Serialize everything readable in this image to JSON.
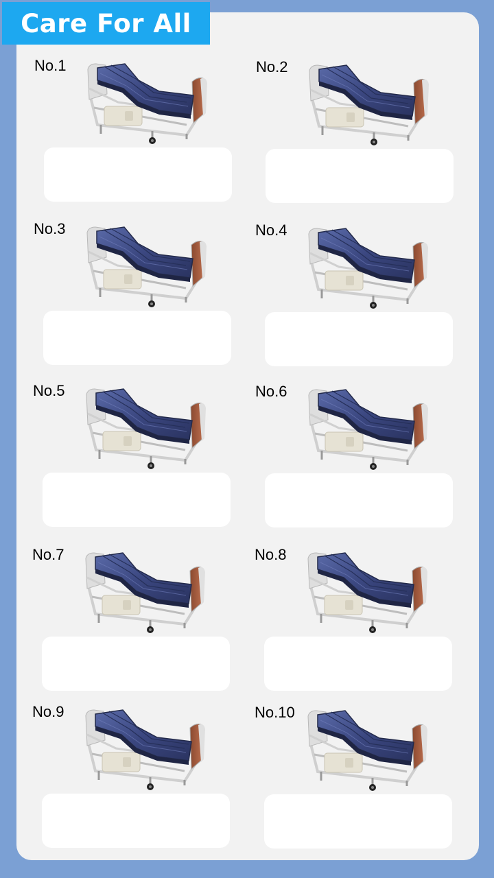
{
  "header": {
    "title": "Care For All"
  },
  "colors": {
    "background": "#7ba0d4",
    "banner": "#1da8f0",
    "panel": "#f2f2f2",
    "mattress": "#3d4a7a"
  },
  "items": [
    {
      "label": "No.1",
      "icon": "hospital-bed-icon"
    },
    {
      "label": "No.2",
      "icon": "hospital-bed-icon"
    },
    {
      "label": "No.3",
      "icon": "hospital-bed-icon"
    },
    {
      "label": "No.4",
      "icon": "hospital-bed-icon"
    },
    {
      "label": "No.5",
      "icon": "hospital-bed-icon"
    },
    {
      "label": "No.6",
      "icon": "hospital-bed-icon"
    },
    {
      "label": "No.7",
      "icon": "hospital-bed-icon"
    },
    {
      "label": "No.8",
      "icon": "hospital-bed-icon"
    },
    {
      "label": "No.9",
      "icon": "hospital-bed-icon"
    },
    {
      "label": "No.10",
      "icon": "hospital-bed-icon"
    }
  ]
}
